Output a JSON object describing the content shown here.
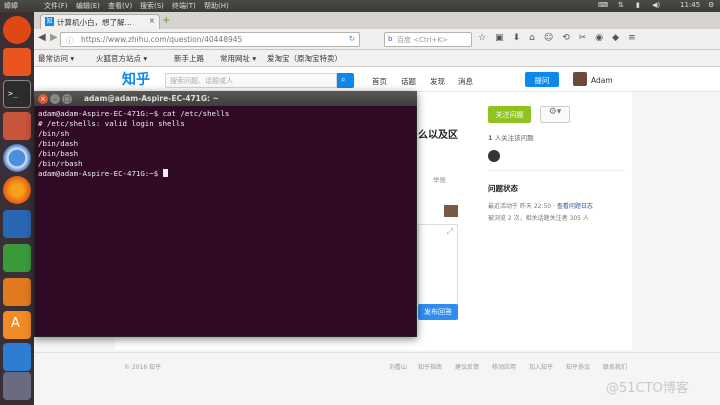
{
  "system": {
    "app_name": "蟑蟑",
    "menus": [
      "文件(F)",
      "编辑(E)",
      "查看(V)",
      "搜索(S)",
      "终端(T)",
      "帮助(H)"
    ],
    "clock": "11:45"
  },
  "browser": {
    "tab_title": "计算机小白，想了解…",
    "url": "https://www.zhihu.com/question/40448945",
    "search_placeholder": "百度 <Ctrl+K>",
    "bookmarks": [
      "最常访问 ▾",
      "火狐官方站点 ▾",
      "新手上路",
      "常用网址 ▾",
      "爱淘宝（原淘宝特卖）"
    ]
  },
  "zhihu": {
    "logo": "知乎",
    "search_placeholder": "搜索问题、话题或人",
    "nav": [
      "首页",
      "话题",
      "发现",
      "消息"
    ],
    "ask_label": "提问",
    "user": "Adam",
    "question_fragment": "么以及区",
    "follow_label": "关注问题",
    "followers_count": "1",
    "followers_text": "人关注该问题",
    "status_title": "问题状态",
    "last_active": "最近活动于 昨天 22:50 · ",
    "view_log": "查看问题日志",
    "viewed_text": "被浏览 2 次，相关话题关注者 305 人",
    "report": "举报",
    "publish": "发布回答",
    "copyright": "© 2016 知乎",
    "footer_links": [
      "刘看山",
      "知乎指南",
      "建议反馈",
      "移动应用",
      "加入知乎",
      "知乎协议",
      "联系我们"
    ]
  },
  "terminal": {
    "title": "adam@adam-Aspire-EC-471G: ~",
    "lines": [
      "adam@adam-Aspire-EC-471G:~$ cat /etc/shells",
      "# /etc/shells: valid login shells",
      "/bin/sh",
      "/bin/dash",
      "/bin/bash",
      "/bin/rbash"
    ],
    "prompt": "adam@adam-Aspire-EC-471G:~$ "
  },
  "watermark": "@51CTO博客",
  "colors": {
    "accent": "#0f88eb",
    "follow": "#8fc31f",
    "terminal_bg": "#300a24",
    "launcher_bg": "#3b2f36"
  }
}
